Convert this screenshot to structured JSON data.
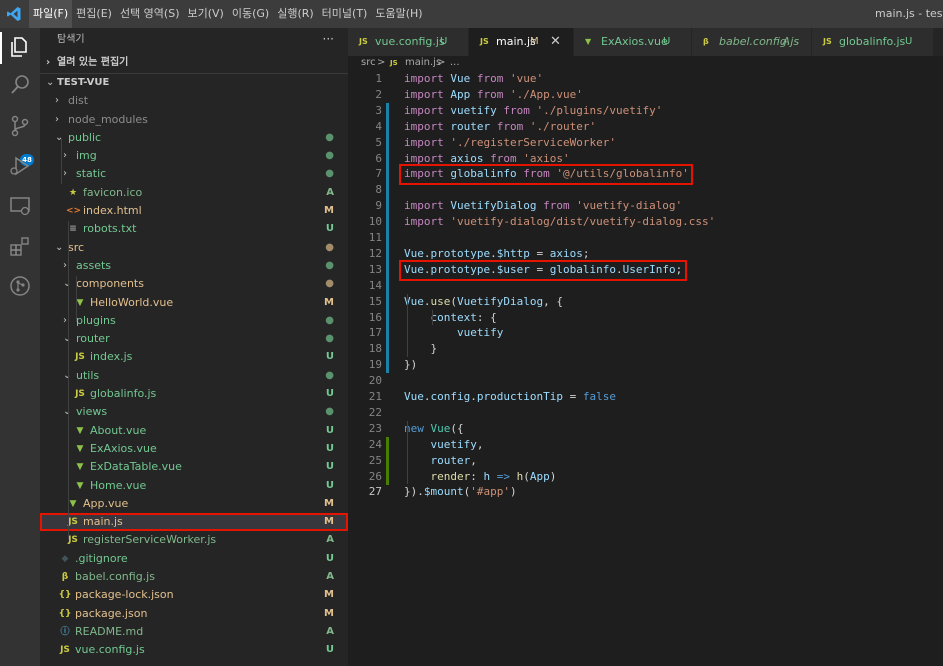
{
  "menu": [
    "파일(F)",
    "편집(E)",
    "선택 영역(S)",
    "보기(V)",
    "이동(G)",
    "실행(R)",
    "터미널(T)",
    "도움말(H)"
  ],
  "window_title": "main.js - test-vue",
  "activity": [
    "explorer-icon",
    "search-icon",
    "source-control-icon",
    "run-debug-icon",
    "remote-explorer-icon",
    "extensions-icon",
    "git-graph-icon"
  ],
  "scm_badge": "48",
  "sidebar": {
    "title": "탐색기",
    "more": "···",
    "open_editors": "열려 있는 편집기",
    "project": "TEST-VUE",
    "items": [
      {
        "label": "dist",
        "depth": 1,
        "kind": "folder",
        "open": false,
        "status": "",
        "color": "ignored"
      },
      {
        "label": "node_modules",
        "depth": 1,
        "kind": "folder",
        "open": false,
        "status": "",
        "color": "ignored"
      },
      {
        "label": "public",
        "depth": 1,
        "kind": "folder",
        "open": true,
        "status": "●",
        "color": "untracked"
      },
      {
        "label": "img",
        "depth": 2,
        "kind": "folder",
        "open": false,
        "status": "●",
        "color": "untracked"
      },
      {
        "label": "static",
        "depth": 2,
        "kind": "folder",
        "open": false,
        "status": "●",
        "color": "untracked"
      },
      {
        "label": "favicon.ico",
        "depth": 2,
        "kind": "star",
        "status": "A",
        "color": "added"
      },
      {
        "label": "index.html",
        "depth": 2,
        "kind": "html",
        "status": "M",
        "color": "modified"
      },
      {
        "label": "robots.txt",
        "depth": 2,
        "kind": "txt",
        "status": "U",
        "color": "untracked"
      },
      {
        "label": "src",
        "depth": 1,
        "kind": "folder",
        "open": true,
        "status": "●",
        "color": "modified"
      },
      {
        "label": "assets",
        "depth": 2,
        "kind": "folder",
        "open": false,
        "status": "●",
        "color": "untracked"
      },
      {
        "label": "components",
        "depth": 2,
        "kind": "folder",
        "open": true,
        "status": "●",
        "color": "modified"
      },
      {
        "label": "HelloWorld.vue",
        "depth": 3,
        "kind": "vue",
        "status": "M",
        "color": "modified"
      },
      {
        "label": "plugins",
        "depth": 2,
        "kind": "folder",
        "open": false,
        "status": "●",
        "color": "untracked"
      },
      {
        "label": "router",
        "depth": 2,
        "kind": "folder",
        "open": true,
        "status": "●",
        "color": "untracked"
      },
      {
        "label": "index.js",
        "depth": 3,
        "kind": "js",
        "status": "U",
        "color": "untracked"
      },
      {
        "label": "utils",
        "depth": 2,
        "kind": "folder",
        "open": true,
        "status": "●",
        "color": "untracked"
      },
      {
        "label": "globalinfo.js",
        "depth": 3,
        "kind": "js",
        "status": "U",
        "color": "untracked"
      },
      {
        "label": "views",
        "depth": 2,
        "kind": "folder",
        "open": true,
        "status": "●",
        "color": "untracked"
      },
      {
        "label": "About.vue",
        "depth": 3,
        "kind": "vue",
        "status": "U",
        "color": "untracked"
      },
      {
        "label": "ExAxios.vue",
        "depth": 3,
        "kind": "vue",
        "status": "U",
        "color": "untracked"
      },
      {
        "label": "ExDataTable.vue",
        "depth": 3,
        "kind": "vue",
        "status": "U",
        "color": "untracked"
      },
      {
        "label": "Home.vue",
        "depth": 3,
        "kind": "vue",
        "status": "U",
        "color": "untracked"
      },
      {
        "label": "App.vue",
        "depth": 2,
        "kind": "vue",
        "status": "M",
        "color": "modified"
      },
      {
        "label": "main.js",
        "depth": 2,
        "kind": "js",
        "status": "M",
        "color": "modified",
        "selected": true
      },
      {
        "label": "registerServiceWorker.js",
        "depth": 2,
        "kind": "js",
        "status": "A",
        "color": "added"
      },
      {
        "label": ".gitignore",
        "depth": 1,
        "kind": "gitignore",
        "status": "U",
        "color": "untracked"
      },
      {
        "label": "babel.config.js",
        "depth": 1,
        "kind": "babel",
        "status": "A",
        "color": "added"
      },
      {
        "label": "package-lock.json",
        "depth": 1,
        "kind": "json",
        "status": "M",
        "color": "modified"
      },
      {
        "label": "package.json",
        "depth": 1,
        "kind": "json",
        "status": "M",
        "color": "modified"
      },
      {
        "label": "README.md",
        "depth": 1,
        "kind": "info",
        "status": "A",
        "color": "added"
      },
      {
        "label": "vue.config.js",
        "depth": 1,
        "kind": "js",
        "status": "U",
        "color": "untracked"
      }
    ]
  },
  "tabs": [
    {
      "icon": "JS",
      "label": "vue.config.js",
      "status": "U",
      "color": "untracked",
      "active": false,
      "italic": false
    },
    {
      "icon": "JS",
      "label": "main.js",
      "status": "M",
      "color": "modified",
      "active": true,
      "italic": false,
      "close": "✕"
    },
    {
      "icon": "V",
      "label": "ExAxios.vue",
      "status": "U",
      "color": "untracked",
      "active": false,
      "italic": false
    },
    {
      "icon": "B",
      "label": "babel.config.js",
      "status": "A",
      "color": "added",
      "active": false,
      "italic": true
    },
    {
      "icon": "JS",
      "label": "globalinfo.js",
      "status": "U",
      "color": "untracked",
      "active": false,
      "italic": false
    }
  ],
  "breadcrumb": {
    "folder": "src",
    "sep": ">",
    "icon": "JS",
    "file": "main.js",
    "tail": "..."
  },
  "code": [
    [
      [
        "i",
        "import"
      ],
      [
        "p",
        " "
      ],
      [
        "v",
        "Vue"
      ],
      [
        "p",
        " "
      ],
      [
        "i",
        "from"
      ],
      [
        "p",
        " "
      ],
      [
        "s",
        "'vue'"
      ]
    ],
    [
      [
        "i",
        "import"
      ],
      [
        "p",
        " "
      ],
      [
        "v",
        "App"
      ],
      [
        "p",
        " "
      ],
      [
        "i",
        "from"
      ],
      [
        "p",
        " "
      ],
      [
        "s",
        "'./App.vue'"
      ]
    ],
    [
      [
        "i",
        "import"
      ],
      [
        "p",
        " "
      ],
      [
        "v",
        "vuetify"
      ],
      [
        "p",
        " "
      ],
      [
        "i",
        "from"
      ],
      [
        "p",
        " "
      ],
      [
        "s",
        "'./plugins/vuetify'"
      ]
    ],
    [
      [
        "i",
        "import"
      ],
      [
        "p",
        " "
      ],
      [
        "v",
        "router"
      ],
      [
        "p",
        " "
      ],
      [
        "i",
        "from"
      ],
      [
        "p",
        " "
      ],
      [
        "s",
        "'./router'"
      ]
    ],
    [
      [
        "i",
        "import"
      ],
      [
        "p",
        " "
      ],
      [
        "s",
        "'./registerServiceWorker'"
      ]
    ],
    [
      [
        "i",
        "import"
      ],
      [
        "p",
        " "
      ],
      [
        "v",
        "axios"
      ],
      [
        "p",
        " "
      ],
      [
        "i",
        "from"
      ],
      [
        "p",
        " "
      ],
      [
        "s",
        "'axios'"
      ]
    ],
    [
      [
        "i",
        "import"
      ],
      [
        "p",
        " "
      ],
      [
        "v",
        "globalinfo"
      ],
      [
        "p",
        " "
      ],
      [
        "i",
        "from"
      ],
      [
        "p",
        " "
      ],
      [
        "s",
        "'@/utils/globalinfo'"
      ]
    ],
    [],
    [
      [
        "i",
        "import"
      ],
      [
        "p",
        " "
      ],
      [
        "v",
        "VuetifyDialog"
      ],
      [
        "p",
        " "
      ],
      [
        "i",
        "from"
      ],
      [
        "p",
        " "
      ],
      [
        "s",
        "'vuetify-dialog'"
      ]
    ],
    [
      [
        "i",
        "import"
      ],
      [
        "p",
        " "
      ],
      [
        "s",
        "'vuetify-dialog/dist/vuetify-dialog.css'"
      ]
    ],
    [],
    [
      [
        "v",
        "Vue"
      ],
      [
        "p",
        "."
      ],
      [
        "v",
        "prototype"
      ],
      [
        "p",
        "."
      ],
      [
        "v",
        "$http"
      ],
      [
        "p",
        " = "
      ],
      [
        "v",
        "axios"
      ],
      [
        "p",
        ";"
      ]
    ],
    [
      [
        "v",
        "Vue"
      ],
      [
        "p",
        "."
      ],
      [
        "v",
        "prototype"
      ],
      [
        "p",
        "."
      ],
      [
        "v",
        "$user"
      ],
      [
        "p",
        " = "
      ],
      [
        "v",
        "globalinfo"
      ],
      [
        "p",
        "."
      ],
      [
        "v",
        "UserInfo"
      ],
      [
        "p",
        ";"
      ]
    ],
    [],
    [
      [
        "v",
        "Vue"
      ],
      [
        "p",
        "."
      ],
      [
        "f",
        "use"
      ],
      [
        "p",
        "("
      ],
      [
        "v",
        "VuetifyDialog"
      ],
      [
        "p",
        ", {"
      ]
    ],
    [
      [
        "p",
        "    "
      ],
      [
        "v",
        "context"
      ],
      [
        "p",
        ": {"
      ]
    ],
    [
      [
        "p",
        "        "
      ],
      [
        "v",
        "vuetify"
      ]
    ],
    [
      [
        "p",
        "    }"
      ]
    ],
    [
      [
        "p",
        "})"
      ]
    ],
    [],
    [
      [
        "v",
        "Vue"
      ],
      [
        "p",
        "."
      ],
      [
        "v",
        "config"
      ],
      [
        "p",
        "."
      ],
      [
        "v",
        "productionTip"
      ],
      [
        "p",
        " = "
      ],
      [
        "k",
        "false"
      ]
    ],
    [],
    [
      [
        "k",
        "new"
      ],
      [
        "p",
        " "
      ],
      [
        "t",
        "Vue"
      ],
      [
        "p",
        "({"
      ]
    ],
    [
      [
        "p",
        "    "
      ],
      [
        "v",
        "vuetify"
      ],
      [
        "p",
        ","
      ]
    ],
    [
      [
        "p",
        "    "
      ],
      [
        "v",
        "router"
      ],
      [
        "p",
        ","
      ]
    ],
    [
      [
        "p",
        "    "
      ],
      [
        "f",
        "render"
      ],
      [
        "p",
        ": "
      ],
      [
        "v",
        "h"
      ],
      [
        "p",
        " "
      ],
      [
        "k",
        "=>"
      ],
      [
        "p",
        " "
      ],
      [
        "f",
        "h"
      ],
      [
        "p",
        "("
      ],
      [
        "v",
        "App"
      ],
      [
        "p",
        ")"
      ]
    ],
    [
      [
        "p",
        "})."
      ],
      [
        "v",
        "$mount"
      ],
      [
        "p",
        "("
      ],
      [
        "s",
        "'#app'"
      ],
      [
        "p",
        ")"
      ]
    ]
  ],
  "gutter": {
    "modified_lines": [
      3,
      4,
      5,
      6,
      7,
      8,
      9,
      10,
      11,
      12,
      13,
      14,
      15,
      16,
      17,
      18,
      19
    ],
    "added_lines": [
      24,
      25,
      26
    ],
    "current_line": 27
  },
  "highlights": [
    7,
    13
  ],
  "colors": {
    "accent": "#007acc",
    "highlight_box": "#e51400",
    "modified": "#e2c08d",
    "untracked": "#73c991",
    "added": "#81b88b",
    "ignored": "#8c8c8c"
  }
}
